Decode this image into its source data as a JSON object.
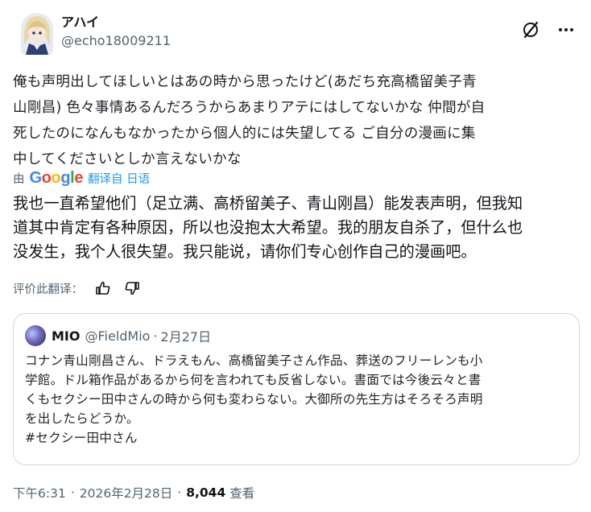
{
  "author": {
    "display_name": "アハイ",
    "handle": "@echo18009211"
  },
  "header_icons": [
    "grok-icon",
    "more-icon"
  ],
  "tweet": {
    "original_text": "俺も声明出してほしいとはあの時から思ったけど(あだち充高橋留美子青\n山剛昌) 色々事情あるんだろうからあまりアテにはしてないかな  仲間が自\n死したのになんもなかったから個人的には失望してる   ご自分の漫画に集\n中してくださいとしか言えないかな",
    "translated_by_prefix": "由",
    "translation_provider": "Google",
    "translated_from": "翻译自 日语",
    "translated_text": "我也一直希望他们（足立满、高桥留美子、青山刚昌）能发表声明，但我知\n道其中肯定有各种原因，所以也没抱太大希望。我的朋友自杀了，但什么也\n没发生，我个人很失望。我只能说，请你们专心创作自己的漫画吧。",
    "rate_label": "评价此翻译："
  },
  "quoted": {
    "name": "MIO",
    "handle": "@FieldMio",
    "separator": "·",
    "date": "2月27日",
    "text": "コナン青山剛昌さん、ドラえもん、高橋留美子さん作品、葬送のフリーレンも小\n学館。ドル箱作品があるから何を言われても反省しない。書面では今後云々と書\nくもセクシー田中さんの時から何も変わらない。大御所の先生方はそろそろ声明\nを出したらどうか。\n#セクシー田中さん"
  },
  "meta": {
    "time": "下午6:31",
    "separator": "·",
    "date": "2026年2月28日",
    "views_count": "8,044",
    "views_label": "查看"
  },
  "colors": {
    "text": "#0f1419",
    "secondary": "#536471",
    "link": "#1d9bf0",
    "border": "#cfd9de"
  }
}
